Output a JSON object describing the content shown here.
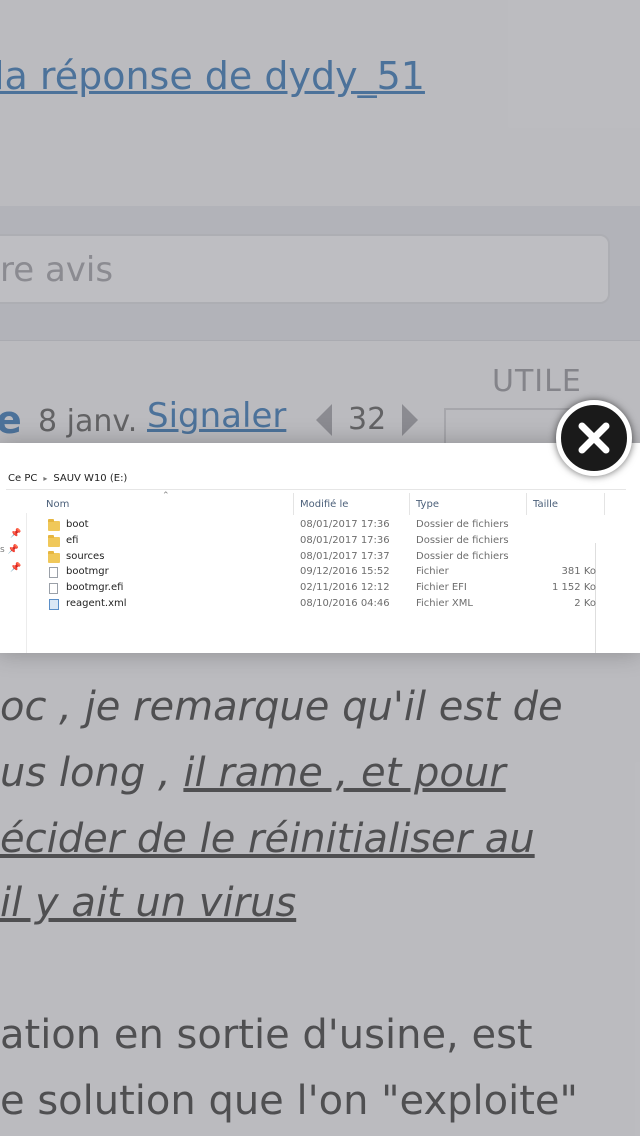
{
  "background": {
    "reply_link": "la réponse de dydy_51",
    "avis_placeholder": "re avis",
    "utile_label": "UTILE",
    "author_initial": "e",
    "date": "8 janv.",
    "signaler_label": "Signaler",
    "vote_count": "32",
    "body_lines": [
      {
        "text": "oc , je remarque qu'il est de"
      },
      {
        "a": "us long , ",
        "b": "il rame , et pour"
      },
      {
        "text": "écider de le réinitialiser au"
      },
      {
        "text": "il y ait un virus"
      },
      {
        "text": "ation en sortie d'usine, est"
      },
      {
        "text": "e solution que l'on \"exploite\""
      }
    ]
  },
  "explorer": {
    "breadcrumb": [
      "Ce PC",
      "SAUV W10 (E:)"
    ],
    "columns": {
      "name": "Nom",
      "modified": "Modifié le",
      "type": "Type",
      "size": "Taille"
    },
    "rows": [
      {
        "name": "boot",
        "modified": "08/01/2017 17:36",
        "type": "Dossier de fichiers",
        "size": "",
        "icon": "folder"
      },
      {
        "name": "efi",
        "modified": "08/01/2017 17:36",
        "type": "Dossier de fichiers",
        "size": "",
        "icon": "folder"
      },
      {
        "name": "sources",
        "modified": "08/01/2017 17:37",
        "type": "Dossier de fichiers",
        "size": "",
        "icon": "folder"
      },
      {
        "name": "bootmgr",
        "modified": "09/12/2016 15:52",
        "type": "Fichier",
        "size": "381 Ko",
        "icon": "file"
      },
      {
        "name": "bootmgr.efi",
        "modified": "02/11/2016 12:12",
        "type": "Fichier EFI",
        "size": "1 152 Ko",
        "icon": "file"
      },
      {
        "name": "reagent.xml",
        "modified": "08/10/2016 04:46",
        "type": "Fichier XML",
        "size": "2 Ko",
        "icon": "xml-file"
      }
    ],
    "side_fragment": "s"
  },
  "colors": {
    "link": "#2e6eb0",
    "folder": "#f0c85a",
    "close_bg": "#1a1a1a"
  }
}
